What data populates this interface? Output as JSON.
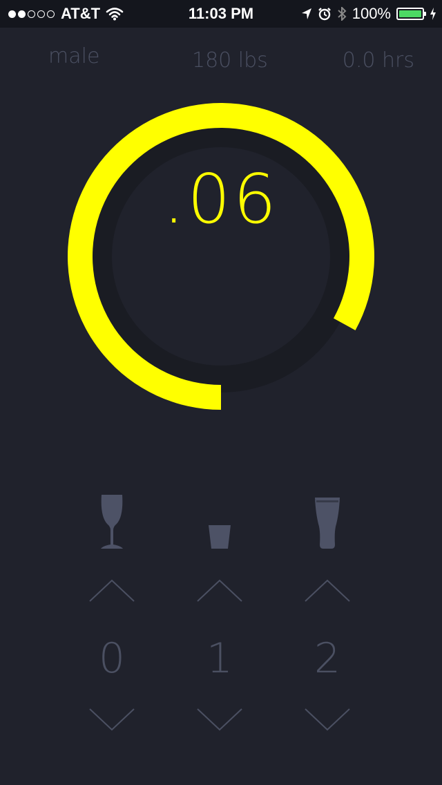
{
  "status_bar": {
    "signal_bars_on": 2,
    "signal_bars_total": 5,
    "carrier": "AT&T",
    "time": "11:03 PM",
    "battery": "100%",
    "battery_level": 1.0,
    "icons": [
      "wifi-icon",
      "location-arrow-icon",
      "alarm-icon",
      "bluetooth-icon",
      "battery-icon",
      "charging-icon"
    ]
  },
  "settings": {
    "gender": "male",
    "weight": "180 lbs",
    "hours": "0.0 hrs"
  },
  "gauge": {
    "value_label": ".06",
    "fill_fraction": 0.83,
    "colors": {
      "fill": "#ffff00",
      "track": "#1a1c23",
      "inner": "#20222c"
    }
  },
  "drinks": [
    {
      "name": "wine",
      "icon": "wine-glass-icon",
      "count": "0"
    },
    {
      "name": "shot",
      "icon": "shot-glass-icon",
      "count": "1"
    },
    {
      "name": "beer",
      "icon": "beer-glass-icon",
      "count": "2"
    }
  ],
  "colors": {
    "background": "#20222c",
    "status_bar": "#14161d",
    "muted": "#4b5062",
    "icon": "#4d5266",
    "accent": "#ffff00"
  }
}
